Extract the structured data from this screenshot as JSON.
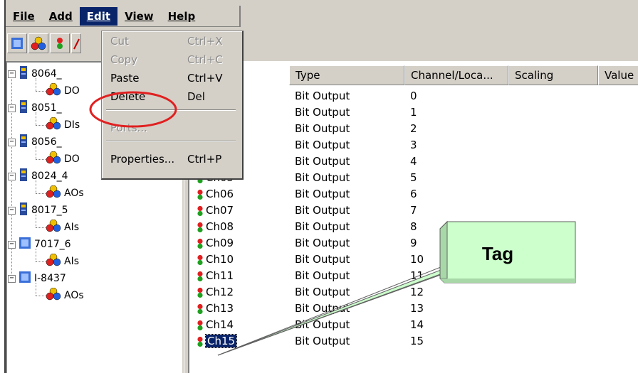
{
  "menubar": {
    "items": [
      {
        "label": "File"
      },
      {
        "label": "Add"
      },
      {
        "label": "Edit"
      },
      {
        "label": "View"
      },
      {
        "label": "Help"
      }
    ]
  },
  "edit_menu": {
    "items": [
      {
        "label": "Cut",
        "shortcut": "Ctrl+X",
        "disabled": true
      },
      {
        "label": "Copy",
        "shortcut": "Ctrl+C",
        "disabled": true
      },
      {
        "label": "Paste",
        "shortcut": "Ctrl+V",
        "disabled": false
      },
      {
        "label": "Delete",
        "shortcut": "Del",
        "disabled": false,
        "highlighted": true
      },
      {
        "label": "Ports...",
        "shortcut": "",
        "disabled": true
      },
      {
        "label": "Properties...",
        "shortcut": "Ctrl+P",
        "disabled": false
      }
    ]
  },
  "tree": {
    "nodes": [
      {
        "label": "8064_",
        "child": "DO"
      },
      {
        "label": "8051_",
        "child": "DIs"
      },
      {
        "label": "8056_",
        "child": "DO"
      },
      {
        "label": "8024_4",
        "child": "AOs"
      },
      {
        "label": "8017_5",
        "child": "AIs"
      },
      {
        "label": "7017_6",
        "child": "AIs"
      },
      {
        "label": "I-8437",
        "child": "AOs"
      }
    ]
  },
  "list": {
    "columns": [
      "Type",
      "Channel/Loca...",
      "Scaling",
      "Value"
    ],
    "rows": [
      {
        "name": "",
        "type": "Bit Output",
        "channel": "0"
      },
      {
        "name": "",
        "type": "Bit Output",
        "channel": "1"
      },
      {
        "name": "",
        "type": "Bit Output",
        "channel": "2"
      },
      {
        "name": "",
        "type": "Bit Output",
        "channel": "3"
      },
      {
        "name": "",
        "type": "Bit Output",
        "channel": "4"
      },
      {
        "name": "Ch05",
        "type": "Bit Output",
        "channel": "5"
      },
      {
        "name": "Ch06",
        "type": "Bit Output",
        "channel": "6"
      },
      {
        "name": "Ch07",
        "type": "Bit Output",
        "channel": "7"
      },
      {
        "name": "Ch08",
        "type": "Bit Output",
        "channel": "8"
      },
      {
        "name": "Ch09",
        "type": "Bit Output",
        "channel": "9"
      },
      {
        "name": "Ch10",
        "type": "Bit Output",
        "channel": "10"
      },
      {
        "name": "Ch11",
        "type": "Bit Output",
        "channel": "11"
      },
      {
        "name": "Ch12",
        "type": "Bit Output",
        "channel": "12"
      },
      {
        "name": "Ch13",
        "type": "Bit Output",
        "channel": "13"
      },
      {
        "name": "Ch14",
        "type": "Bit Output",
        "channel": "14"
      },
      {
        "name": "Ch15",
        "type": "Bit Output",
        "channel": "15",
        "selected": true
      }
    ]
  },
  "callout": {
    "label": "Tag"
  },
  "colors": {
    "face": "#d4d0c8",
    "selection": "#0a246a",
    "callout_fill": "#ccffcc",
    "highlight_ellipse": "#e02020"
  }
}
